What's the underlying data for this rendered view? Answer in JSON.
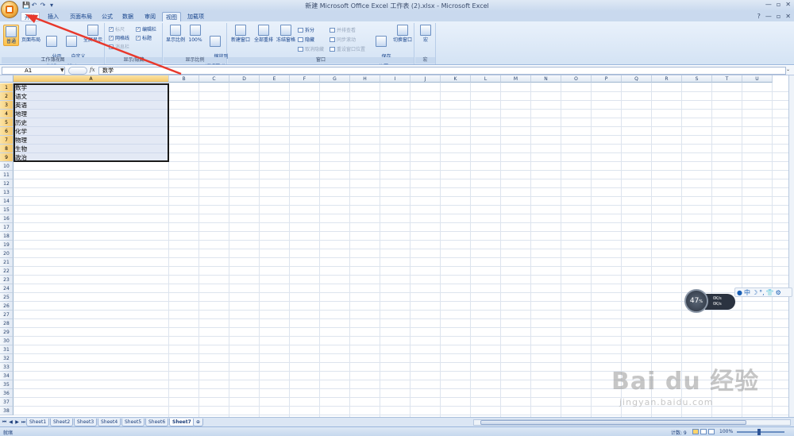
{
  "window": {
    "title": "新建 Microsoft Office Excel 工作表 (2).xlsx - Microsoft Excel",
    "controls": [
      "—",
      "▫",
      "✕"
    ]
  },
  "qat": [
    "💾",
    "↶",
    "↷",
    "▾"
  ],
  "tabs": [
    "开始",
    "插入",
    "页面布局",
    "公式",
    "数据",
    "审阅",
    "视图",
    "加载项"
  ],
  "active_tab": "视图",
  "ribbon_right": [
    "?",
    "—",
    "▫",
    "✕"
  ],
  "ribbon": {
    "workbook_views": {
      "label": "工作簿视图",
      "buttons": [
        "普通",
        "页面布局",
        "分页\n预览",
        "自定义\n视图",
        "全屏显示"
      ]
    },
    "show_hide": {
      "label": "显示/隐藏",
      "checks": [
        {
          "label": "标尺",
          "checked": true,
          "disabled": true
        },
        {
          "label": "编辑栏",
          "checked": true,
          "disabled": false
        },
        {
          "label": "网格线",
          "checked": true,
          "disabled": false
        },
        {
          "label": "标题",
          "checked": true,
          "disabled": false
        },
        {
          "label": "消息栏",
          "checked": false,
          "disabled": true
        }
      ]
    },
    "zoom": {
      "label": "显示比例",
      "buttons": [
        "显示比例",
        "100%",
        "缩放到\n选定区域"
      ]
    },
    "window": {
      "label": "窗口",
      "buttons": [
        "新建窗口",
        "全部重排",
        "冻结窗格",
        "保存\n工作区",
        "切换窗口"
      ],
      "small": [
        {
          "label": "拆分",
          "disabled": false
        },
        {
          "label": "隐藏",
          "disabled": false
        },
        {
          "label": "取消隐藏",
          "disabled": true
        },
        {
          "label": "并排查看",
          "disabled": true
        },
        {
          "label": "同步滚动",
          "disabled": true
        },
        {
          "label": "重设窗口位置",
          "disabled": true
        }
      ]
    },
    "macro": {
      "label": "宏",
      "buttons": [
        "宏"
      ]
    }
  },
  "formula_bar": {
    "name_box": "A1",
    "fx": "fx",
    "content": "数学"
  },
  "columns": [
    "A",
    "B",
    "C",
    "D",
    "E",
    "F",
    "G",
    "H",
    "I",
    "J",
    "K",
    "L",
    "M",
    "N",
    "O",
    "P",
    "Q",
    "R",
    "S",
    "T",
    "U"
  ],
  "rows": [
    "1",
    "2",
    "3",
    "4",
    "5",
    "6",
    "7",
    "8",
    "9",
    "10",
    "11",
    "12",
    "13",
    "14",
    "15",
    "16",
    "17",
    "18",
    "19",
    "20",
    "21",
    "22",
    "23",
    "24",
    "25",
    "26",
    "27",
    "28",
    "29",
    "30",
    "31",
    "32",
    "33",
    "34",
    "35",
    "36",
    "37",
    "38"
  ],
  "cells_a": [
    "数学",
    "语文",
    "英语",
    "地理",
    "历史",
    "化学",
    "物理",
    "生物",
    "政治"
  ],
  "sheets": [
    "Sheet1",
    "Sheet2",
    "Sheet3",
    "Sheet4",
    "Sheet5",
    "Sheet6",
    "Sheet7"
  ],
  "active_sheet": "Sheet7",
  "status": {
    "ready": "就绪",
    "count": "计数: 9",
    "zoom": "100%"
  },
  "net_widget": {
    "percent": "47",
    "unit": "%",
    "up": "0K/s",
    "down": "0K/s"
  },
  "ime_bar": {
    "items": [
      "中",
      "☽",
      "°,",
      "👕",
      "⚙"
    ]
  },
  "watermark": {
    "main": "Bai du 经验",
    "sub": "jingyan.baidu.com"
  },
  "colors": {
    "ribbon": "#dfe9f5",
    "selection_border": "#1a1a1a",
    "arrow": "#e8382c"
  }
}
